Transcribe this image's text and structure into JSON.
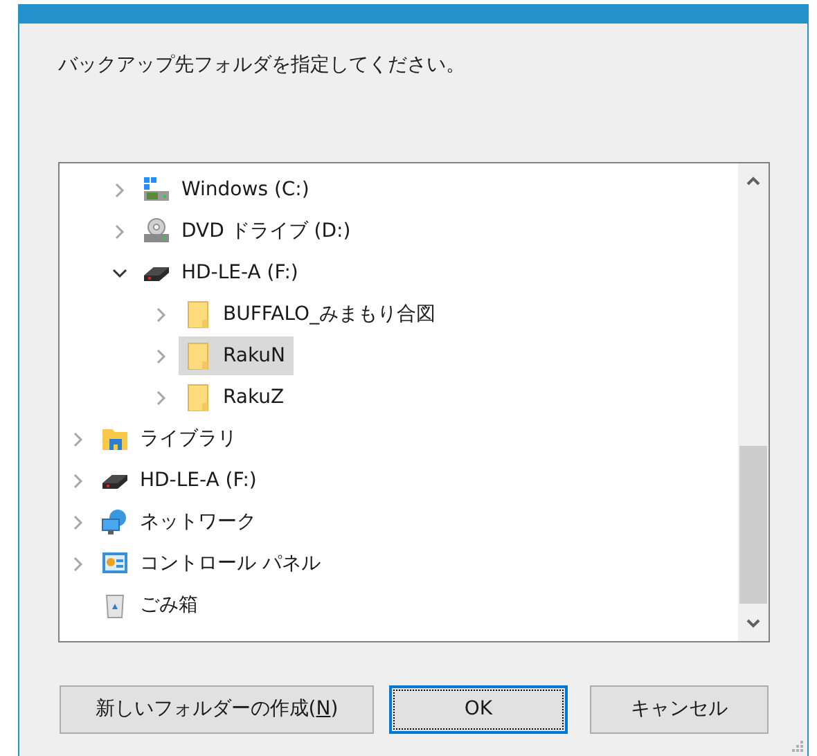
{
  "prompt": "バックアップ先フォルダを指定してください。",
  "tree": {
    "items": [
      {
        "kind": "offscreen",
        "children": [
          {
            "label": "Windows (C:)",
            "kind": "system-drive",
            "expanded": false,
            "selected": false
          },
          {
            "label": "DVD ドライブ (D:)",
            "kind": "dvd",
            "expanded": false,
            "selected": false
          },
          {
            "label": "HD-LE-A (F:)",
            "kind": "hdd",
            "expanded": true,
            "selected": false,
            "children": [
              {
                "label": "BUFFALO_みまもり合図",
                "kind": "folder",
                "expanded": false,
                "selected": false
              },
              {
                "label": "RakuN",
                "kind": "folder",
                "expanded": false,
                "selected": true
              },
              {
                "label": "RakuZ",
                "kind": "folder",
                "expanded": false,
                "selected": false
              }
            ]
          }
        ]
      },
      {
        "label": "ライブラリ",
        "kind": "library",
        "expanded": false,
        "selected": false
      },
      {
        "label": "HD-LE-A (F:)",
        "kind": "hdd",
        "expanded": false,
        "selected": false
      },
      {
        "label": "ネットワーク",
        "kind": "network",
        "expanded": false,
        "selected": false
      },
      {
        "label": "コントロール パネル",
        "kind": "control-panel",
        "expanded": false,
        "selected": false
      },
      {
        "label": "ごみ箱",
        "kind": "recycle-bin",
        "selected": false
      }
    ]
  },
  "buttons": [
    {
      "label": "新しいフォルダーの作成(**N**)",
      "default": false
    },
    {
      "label": "OK",
      "default": true
    },
    {
      "label": "キャンセル",
      "default": false
    }
  ]
}
